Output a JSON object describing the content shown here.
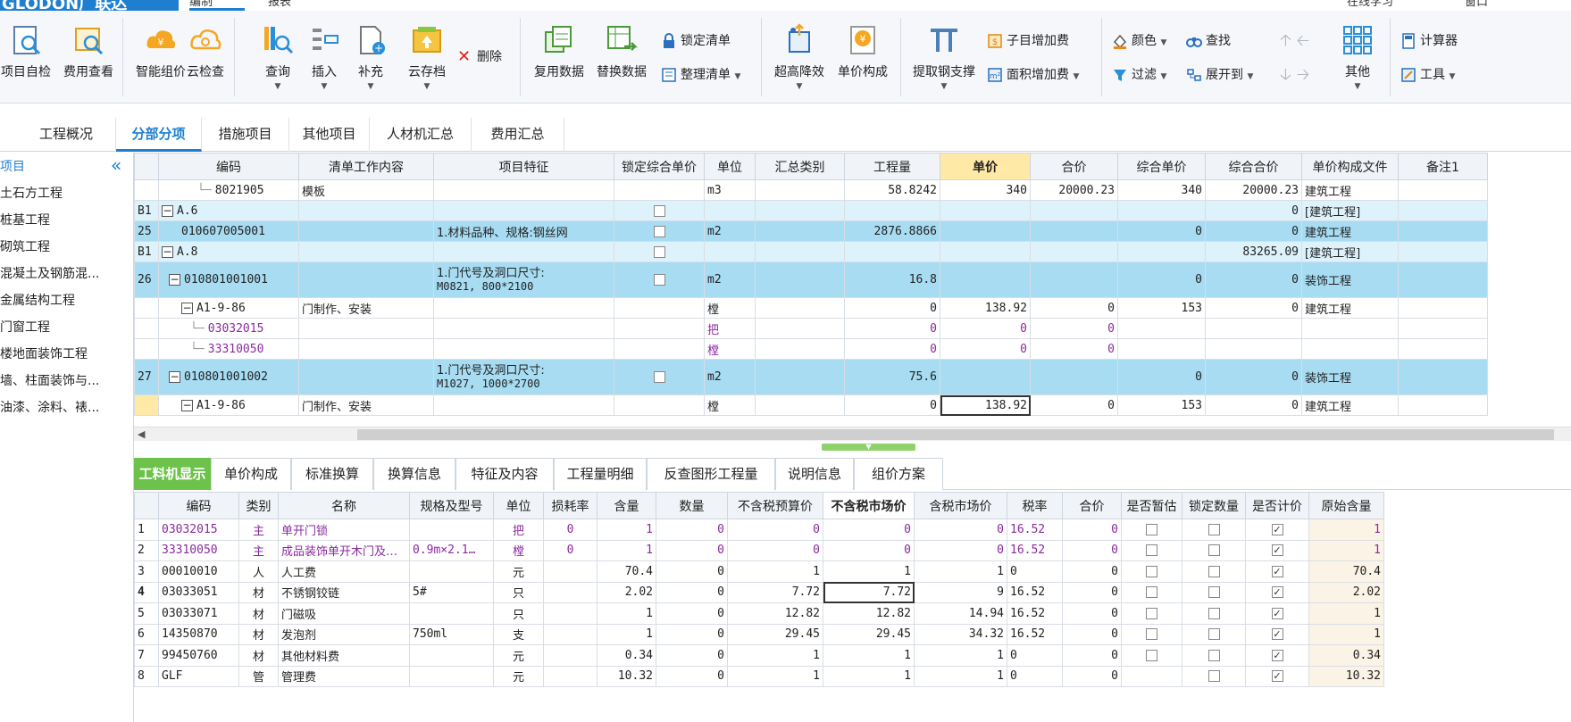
{
  "titlebar": {
    "logo": "GLODON广联达",
    "tab1": "编制",
    "tab2": "报表",
    "right1": "在线学习",
    "right2": "窗口"
  },
  "ribbon": {
    "project_check": "项目自检",
    "fee_view": "费用查看",
    "smart_price": "智能组价",
    "cloud_check": "云检查",
    "query": "查询",
    "insert": "插入",
    "supplement": "补充",
    "cloud_save": "云存档",
    "delete": "删除",
    "reuse_data": "复用数据",
    "replace_data": "替换数据",
    "lock_list": "锁定清单",
    "sort_list": "整理清单",
    "super_height": "超高降效",
    "unit_price_comp": "单价构成",
    "steel_support": "提取钢支撑",
    "sub_add_fee": "子目增加费",
    "area_add_fee": "面积增加费",
    "color": "颜色",
    "find": "查找",
    "filter": "过滤",
    "expand_to": "展开到",
    "other": "其他",
    "calculator": "计算器",
    "tools": "工具"
  },
  "tabs": [
    "工程概况",
    "分部分项",
    "措施项目",
    "其他项目",
    "人材机汇总",
    "费用汇总"
  ],
  "active_tab": "分部分项",
  "lefttree": [
    "项目",
    "土石方工程",
    "桩基工程",
    "砌筑工程",
    "混凝土及钢筋混...",
    "金属结构工程",
    "门窗工程",
    "楼地面装饰工程",
    "墙、柱面装饰与...",
    "油漆、涂料、裱..."
  ],
  "top_grid": {
    "headers": [
      "编码",
      "清单工作内容",
      "项目特征",
      "锁定综合单价",
      "单位",
      "汇总类别",
      "工程量",
      "单价",
      "合价",
      "综合单价",
      "综合合价",
      "单价构成文件",
      "备注1"
    ],
    "rows": [
      {
        "no": "",
        "code": "8021905",
        "content": "模板",
        "feature": "",
        "lock": "",
        "unit": "m3",
        "sum": "",
        "qty": "58.8242",
        "price": "340",
        "total": "20000.23",
        "cprice": "340",
        "ctotal": "20000.23",
        "file": "建筑工程"
      },
      {
        "no": "B1",
        "code": "A.6",
        "content": "",
        "feature": "",
        "lock": "box",
        "unit": "",
        "sum": "",
        "qty": "",
        "price": "",
        "total": "",
        "cprice": "",
        "ctotal": "0",
        "file": "[建筑工程]"
      },
      {
        "no": "25",
        "code": "010607005001",
        "content": "",
        "feature": "1.材料品种、规格:钢丝网",
        "lock": "box",
        "unit": "m2",
        "sum": "",
        "qty": "2876.8866",
        "price": "",
        "total": "",
        "cprice": "0",
        "ctotal": "0",
        "file": "建筑工程"
      },
      {
        "no": "B1",
        "code": "A.8",
        "content": "",
        "feature": "",
        "lock": "box",
        "unit": "",
        "sum": "",
        "qty": "",
        "price": "",
        "total": "",
        "cprice": "",
        "ctotal": "83265.09",
        "file": "[建筑工程]"
      },
      {
        "no": "26",
        "code": "010801001001",
        "content": "",
        "feature1": "1.门代号及洞口尺寸:",
        "feature2": "M0821, 800*2100",
        "lock": "box",
        "unit": "m2",
        "sum": "",
        "qty": "16.8",
        "price": "",
        "total": "",
        "cprice": "0",
        "ctotal": "0",
        "file": "装饰工程"
      },
      {
        "no": "",
        "code": "A1-9-86",
        "content": "门制作、安装",
        "feature": "",
        "lock": "",
        "unit": "樘",
        "sum": "",
        "qty": "0",
        "price": "138.92",
        "total": "0",
        "cprice": "153",
        "ctotal": "0",
        "file": "建筑工程"
      },
      {
        "no": "",
        "code": "03032015",
        "content": "",
        "feature": "",
        "lock": "",
        "unit": "把",
        "sum": "",
        "qty": "0",
        "price": "0",
        "total": "0",
        "cprice": "",
        "ctotal": "",
        "file": ""
      },
      {
        "no": "",
        "code": "33310050",
        "content": "",
        "feature": "",
        "lock": "",
        "unit": "樘",
        "sum": "",
        "qty": "0",
        "price": "0",
        "total": "0",
        "cprice": "",
        "ctotal": "",
        "file": ""
      },
      {
        "no": "27",
        "code": "010801001002",
        "content": "",
        "feature1": "1.门代号及洞口尺寸:",
        "feature2": "M1027, 1000*2700",
        "lock": "box",
        "unit": "m2",
        "sum": "",
        "qty": "75.6",
        "price": "",
        "total": "",
        "cprice": "0",
        "ctotal": "0",
        "file": "装饰工程"
      },
      {
        "no": "",
        "code": "A1-9-86",
        "content": "门制作、安装",
        "feature": "",
        "lock": "",
        "unit": "樘",
        "sum": "",
        "qty": "0",
        "price": "138.92",
        "total": "0",
        "cprice": "153",
        "ctotal": "0",
        "file": "建筑工程"
      }
    ]
  },
  "bottom_tabs": [
    "工料机显示",
    "单价构成",
    "标准换算",
    "换算信息",
    "特征及内容",
    "工程量明细",
    "反查图形工程量",
    "说明信息",
    "组价方案"
  ],
  "active_bottom_tab": "工料机显示",
  "bottom_grid": {
    "headers": [
      "编码",
      "类别",
      "名称",
      "规格及型号",
      "单位",
      "损耗率",
      "含量",
      "数量",
      "不含税预算价",
      "不含税市场价",
      "含税市场价",
      "税率",
      "合价",
      "是否暂估",
      "锁定数量",
      "是否计价",
      "原始含量"
    ],
    "rows": [
      {
        "no": "1",
        "code": "03032015",
        "cat": "主",
        "name": "单开门锁",
        "spec": "",
        "unit": "把",
        "loss": "0",
        "amount": "1",
        "qty": "0",
        "budget": "0",
        "market": "0",
        "taxmarket": "0",
        "rate": "16.52",
        "total": "0",
        "est": false,
        "lockq": false,
        "priced": true,
        "orig": "1"
      },
      {
        "no": "2",
        "code": "33310050",
        "cat": "主",
        "name": "成品装饰单开木门及…",
        "spec": "0.9m×2.1…",
        "unit": "樘",
        "loss": "0",
        "amount": "1",
        "qty": "0",
        "budget": "0",
        "market": "0",
        "taxmarket": "0",
        "rate": "16.52",
        "total": "0",
        "est": false,
        "lockq": false,
        "priced": true,
        "orig": "1"
      },
      {
        "no": "3",
        "code": "00010010",
        "cat": "人",
        "name": "人工费",
        "spec": "",
        "unit": "元",
        "loss": "",
        "amount": "70.4",
        "qty": "0",
        "budget": "1",
        "market": "1",
        "taxmarket": "1",
        "rate": "0",
        "total": "0",
        "est": false,
        "lockq": false,
        "priced": true,
        "orig": "70.4"
      },
      {
        "no": "4",
        "code": "03033051",
        "cat": "材",
        "name": "不锈钢铰链",
        "spec": "5#",
        "unit": "只",
        "loss": "",
        "amount": "2.02",
        "qty": "0",
        "budget": "7.72",
        "market": "7.72",
        "taxmarket": "9",
        "rate": "16.52",
        "total": "0",
        "est": false,
        "lockq": false,
        "priced": true,
        "orig": "2.02"
      },
      {
        "no": "5",
        "code": "03033071",
        "cat": "材",
        "name": "门磁吸",
        "spec": "",
        "unit": "只",
        "loss": "",
        "amount": "1",
        "qty": "0",
        "budget": "12.82",
        "market": "12.82",
        "taxmarket": "14.94",
        "rate": "16.52",
        "total": "0",
        "est": false,
        "lockq": false,
        "priced": true,
        "orig": "1"
      },
      {
        "no": "6",
        "code": "14350870",
        "cat": "材",
        "name": "发泡剂",
        "spec": "750ml",
        "unit": "支",
        "loss": "",
        "amount": "1",
        "qty": "0",
        "budget": "29.45",
        "market": "29.45",
        "taxmarket": "34.32",
        "rate": "16.52",
        "total": "0",
        "est": false,
        "lockq": false,
        "priced": true,
        "orig": "1"
      },
      {
        "no": "7",
        "code": "99450760",
        "cat": "材",
        "name": "其他材料费",
        "spec": "",
        "unit": "元",
        "loss": "",
        "amount": "0.34",
        "qty": "0",
        "budget": "1",
        "market": "1",
        "taxmarket": "1",
        "rate": "0",
        "total": "0",
        "est": false,
        "lockq": false,
        "priced": true,
        "orig": "0.34"
      },
      {
        "no": "8",
        "code": "GLF",
        "cat": "管",
        "name": "管理费",
        "spec": "",
        "unit": "元",
        "loss": "",
        "amount": "10.32",
        "qty": "0",
        "budget": "1",
        "market": "1",
        "taxmarket": "1",
        "rate": "0",
        "total": "0",
        "est": "none",
        "lockq": false,
        "priced": true,
        "orig": "10.32"
      }
    ]
  },
  "colors": {
    "accent": "#1e7fd0",
    "row_blue": "#a7dcf2",
    "row_lightblue": "#ddf2fb",
    "green_tab": "#6cc24a",
    "purple": "#8a2a9e"
  }
}
